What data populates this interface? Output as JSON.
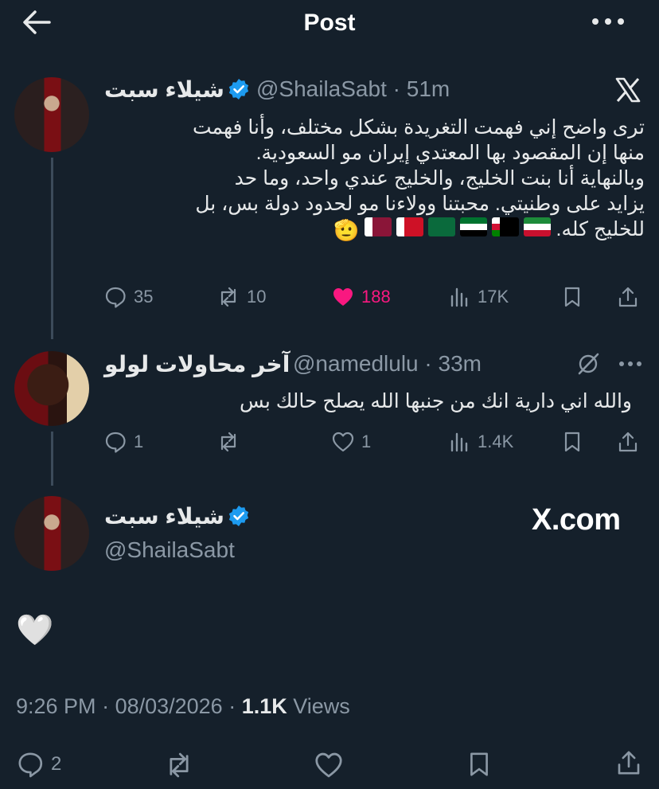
{
  "header": {
    "title": "Post"
  },
  "tweet1": {
    "name": "شيلاء سبت",
    "handle": "@ShailaSabt",
    "time": "51m",
    "lines": [
      "ترى واضح إني فهمت التغريدة بشكل مختلف، وأنا فهمت",
      "منها إن المقصود بها المعتدي إيران مو السعودية.",
      "وبالنهاية أنا بنت الخليج، والخليج عندي واحد، وما حد",
      "يزايد على وطنيتي. محبتنا وولاءنا مو لحدود دولة بس، بل",
      "للخليج كله."
    ],
    "flags": [
      "kuwait",
      "oman",
      "uae",
      "saudi",
      "bahrain",
      "qatar"
    ],
    "emoji": "🫡",
    "stats": {
      "replies": "35",
      "reposts": "10",
      "likes": "188",
      "views": "17K"
    }
  },
  "tweet2": {
    "name": "آخر محاولات لولو",
    "handle": "@namedlulu",
    "time": "33m",
    "text": "والله اني دارية انك من جنبها الله يصلح حالك بس",
    "stats": {
      "replies": "1",
      "reposts": "",
      "likes": "1",
      "views": "1.4K"
    }
  },
  "main": {
    "name": "شيلاء سبت",
    "handle": "@ShailaSabt",
    "watermark": "X.com",
    "text": "🤍",
    "time": "9:26 PM",
    "date": "08/03/2026",
    "views_count": "1.1K",
    "views_label": "Views",
    "stats": {
      "replies": "2"
    }
  },
  "colors": {
    "background": "#15202b",
    "muted": "#8b98a5",
    "like": "#f91880",
    "verified": "#1d9bf0",
    "divider": "#3c4b5a"
  }
}
